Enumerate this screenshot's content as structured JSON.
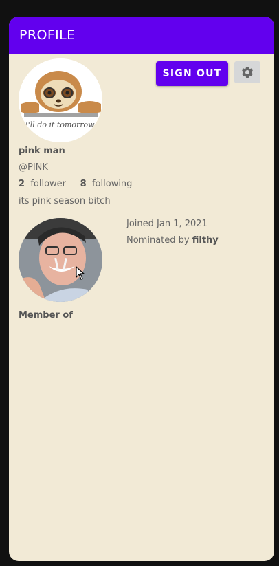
{
  "appbar": {
    "title": "PROFILE"
  },
  "actions": {
    "sign_out_label": "SIGN OUT",
    "settings_icon": "gear-icon"
  },
  "profile": {
    "avatar_caption": "I'll do it tomorrow",
    "name": "pink man",
    "handle": "@PINK",
    "followers_count": "2",
    "followers_label": "follower",
    "following_count": "8",
    "following_label": "following",
    "bio": "its pink season bitch"
  },
  "details": {
    "joined": "Joined Jan 1, 2021",
    "nominated_prefix": "Nominated by",
    "nominated_by": "filthy"
  },
  "member_section": {
    "title": "Member of"
  },
  "colors": {
    "primary": "#6200ee",
    "background": "#f2ead6"
  }
}
